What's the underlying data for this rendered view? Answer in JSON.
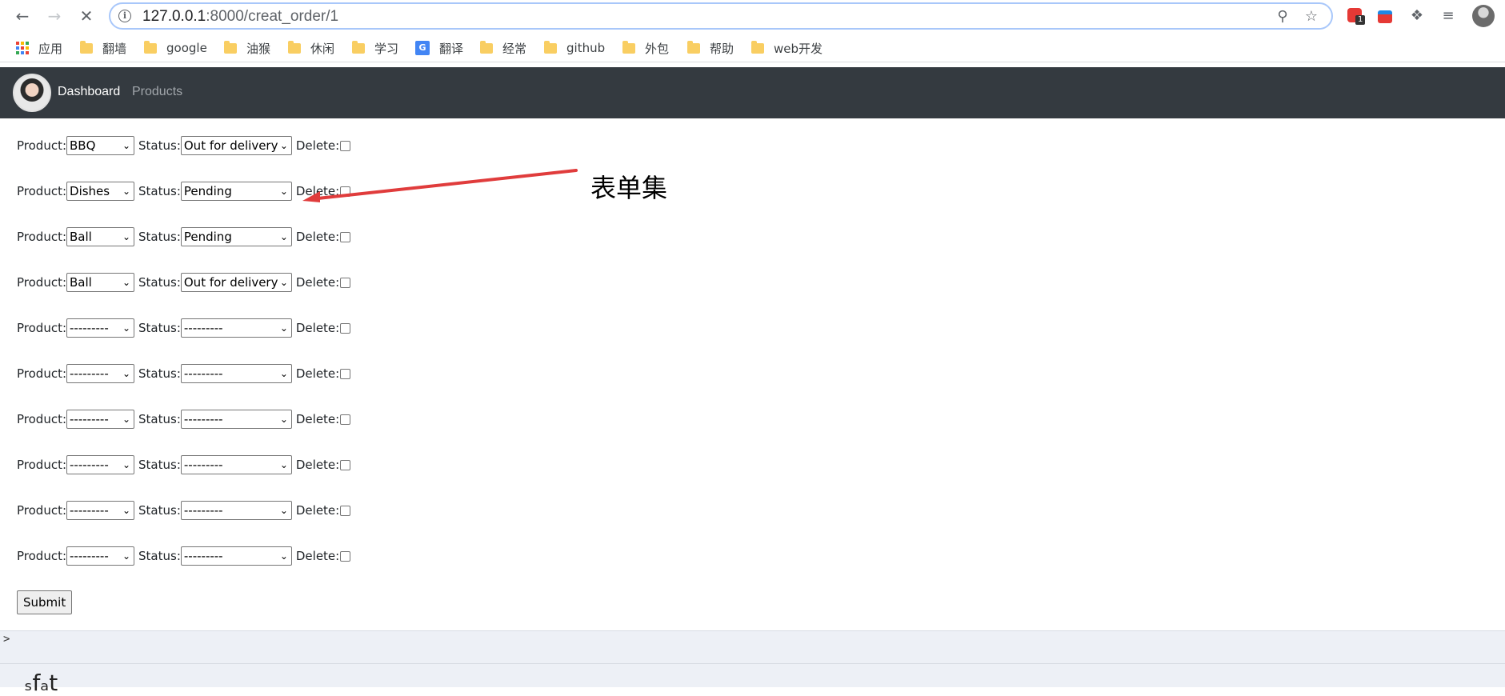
{
  "browser": {
    "url_host": "127.0.0.1",
    "url_path": ":8000/creat_order/1",
    "bookmarks": [
      {
        "label": "应用",
        "kind": "apps"
      },
      {
        "label": "翻墙",
        "kind": "folder"
      },
      {
        "label": "google",
        "kind": "folder"
      },
      {
        "label": "油猴",
        "kind": "folder"
      },
      {
        "label": "休闲",
        "kind": "folder"
      },
      {
        "label": "学习",
        "kind": "folder"
      },
      {
        "label": "翻译",
        "kind": "translate"
      },
      {
        "label": "经常",
        "kind": "folder"
      },
      {
        "label": "github",
        "kind": "folder"
      },
      {
        "label": "外包",
        "kind": "folder"
      },
      {
        "label": "帮助",
        "kind": "folder"
      },
      {
        "label": "web开发",
        "kind": "folder"
      }
    ],
    "extension_badge": "1"
  },
  "navbar": {
    "dashboard_label": "Dashboard",
    "products_label": "Products",
    "bg_color": "#343a40"
  },
  "form": {
    "product_label": "Product:",
    "status_label": "Status:",
    "delete_label": "Delete:",
    "rows": [
      {
        "product": "BBQ",
        "status": "Out for delivery"
      },
      {
        "product": "Dishes",
        "status": "Pending"
      },
      {
        "product": "Ball",
        "status": "Pending"
      },
      {
        "product": "Ball",
        "status": "Out for delivery"
      },
      {
        "product": "---------",
        "status": "---------"
      },
      {
        "product": "---------",
        "status": "---------"
      },
      {
        "product": "---------",
        "status": "---------"
      },
      {
        "product": "---------",
        "status": "---------"
      },
      {
        "product": "---------",
        "status": "---------"
      },
      {
        "product": "---------",
        "status": "---------"
      }
    ],
    "submit_label": "Submit"
  },
  "annotation": {
    "text": "表单集",
    "arrow_color": "#e03c3c"
  },
  "bottom_panel": {
    "prompt": ">",
    "partial_text": "ₛfₐt"
  }
}
